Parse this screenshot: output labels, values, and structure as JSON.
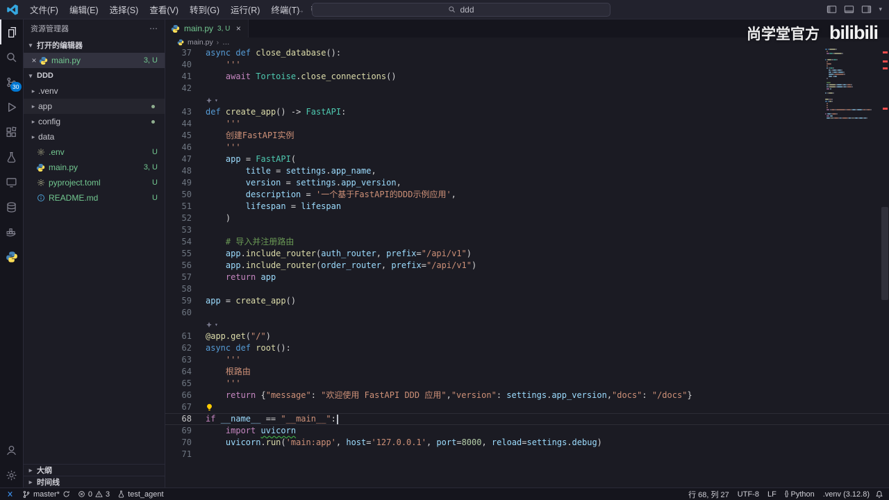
{
  "titlebar": {
    "menus": [
      "文件(F)",
      "编辑(E)",
      "选择(S)",
      "查看(V)",
      "转到(G)",
      "运行(R)",
      "终端(T)",
      "帮助(H)"
    ],
    "search_text": "ddd"
  },
  "activity": {
    "scm_badge": "30"
  },
  "sidebar": {
    "title": "资源管理器",
    "open_editors_label": "打开的编辑器",
    "open_editors": [
      {
        "name": "main.py",
        "badge": "3, U",
        "icon": "python",
        "selected": true
      }
    ],
    "project_label": "DDD",
    "tree": [
      {
        "kind": "folder",
        "name": ".venv"
      },
      {
        "kind": "folder",
        "name": "app",
        "dot": true,
        "focused": true
      },
      {
        "kind": "folder",
        "name": "config",
        "dot": true
      },
      {
        "kind": "folder",
        "name": "data"
      },
      {
        "kind": "file",
        "icon": "gear",
        "name": ".env",
        "badge": "U"
      },
      {
        "kind": "file",
        "icon": "python",
        "name": "main.py",
        "badge": "3, U"
      },
      {
        "kind": "file",
        "icon": "gear",
        "name": "pyproject.toml",
        "badge": "U"
      },
      {
        "kind": "file",
        "icon": "info",
        "name": "README.md",
        "badge": "U"
      }
    ],
    "outline_label": "大纲",
    "timeline_label": "时间线"
  },
  "editor": {
    "tab_name": "main.py",
    "tab_badge": "3, U",
    "breadcrumb_file": "main.py",
    "breadcrumb_more": "…",
    "lines": [
      {
        "n": 37,
        "t": [
          [
            "async",
            "k"
          ],
          [
            " ",
            "p"
          ],
          [
            "def",
            "k"
          ],
          [
            " ",
            "p"
          ],
          [
            "close_database",
            "f"
          ],
          [
            "():",
            "p"
          ]
        ]
      },
      {
        "n": 40,
        "t": [
          [
            "    '''",
            "s"
          ]
        ]
      },
      {
        "n": 41,
        "t": [
          [
            "    ",
            "p"
          ],
          [
            "await",
            "c"
          ],
          [
            " ",
            "p"
          ],
          [
            "Tortoise",
            "t"
          ],
          [
            ".",
            "p"
          ],
          [
            "close_connections",
            "f"
          ],
          [
            "()",
            "p"
          ]
        ]
      },
      {
        "n": 42,
        "t": []
      },
      {
        "decor": true
      },
      {
        "n": 43,
        "t": [
          [
            "def",
            "k"
          ],
          [
            " ",
            "p"
          ],
          [
            "create_app",
            "f"
          ],
          [
            "() -> ",
            "p"
          ],
          [
            "FastAPI",
            "t"
          ],
          [
            ":",
            "p"
          ]
        ]
      },
      {
        "n": 44,
        "t": [
          [
            "    '''",
            "s"
          ]
        ]
      },
      {
        "n": 45,
        "t": [
          [
            "    创建FastAPI实例",
            "s"
          ]
        ]
      },
      {
        "n": 46,
        "t": [
          [
            "    '''",
            "s"
          ]
        ]
      },
      {
        "n": 47,
        "t": [
          [
            "    ",
            "p"
          ],
          [
            "app",
            "v"
          ],
          [
            " = ",
            "p"
          ],
          [
            "FastAPI",
            "t"
          ],
          [
            "(",
            "p"
          ]
        ]
      },
      {
        "n": 48,
        "t": [
          [
            "        ",
            "p"
          ],
          [
            "title",
            "v"
          ],
          [
            " = ",
            "p"
          ],
          [
            "settings",
            "v"
          ],
          [
            ".",
            "p"
          ],
          [
            "app_name",
            "v"
          ],
          [
            ",",
            "p"
          ]
        ]
      },
      {
        "n": 49,
        "t": [
          [
            "        ",
            "p"
          ],
          [
            "version",
            "v"
          ],
          [
            " = ",
            "p"
          ],
          [
            "settings",
            "v"
          ],
          [
            ".",
            "p"
          ],
          [
            "app_version",
            "v"
          ],
          [
            ",",
            "p"
          ]
        ]
      },
      {
        "n": 50,
        "t": [
          [
            "        ",
            "p"
          ],
          [
            "description",
            "v"
          ],
          [
            " = ",
            "p"
          ],
          [
            "'一个基于FastAPI的DDD示例应用'",
            "s"
          ],
          [
            ",",
            "p"
          ]
        ]
      },
      {
        "n": 51,
        "t": [
          [
            "        ",
            "p"
          ],
          [
            "lifespan",
            "v"
          ],
          [
            " = ",
            "p"
          ],
          [
            "lifespan",
            "v"
          ]
        ]
      },
      {
        "n": 52,
        "t": [
          [
            "    )",
            "p"
          ]
        ]
      },
      {
        "n": 53,
        "t": []
      },
      {
        "n": 54,
        "t": [
          [
            "    ",
            "p"
          ],
          [
            "# 导入并注册路由",
            "m"
          ]
        ]
      },
      {
        "n": 55,
        "t": [
          [
            "    ",
            "p"
          ],
          [
            "app",
            "v"
          ],
          [
            ".",
            "p"
          ],
          [
            "include_router",
            "f"
          ],
          [
            "(",
            "p"
          ],
          [
            "auth_router",
            "v"
          ],
          [
            ", ",
            "p"
          ],
          [
            "prefix",
            "v"
          ],
          [
            "=",
            "p"
          ],
          [
            "\"/api/v1\"",
            "s"
          ],
          [
            ")",
            "p"
          ]
        ]
      },
      {
        "n": 56,
        "t": [
          [
            "    ",
            "p"
          ],
          [
            "app",
            "v"
          ],
          [
            ".",
            "p"
          ],
          [
            "include_router",
            "f"
          ],
          [
            "(",
            "p"
          ],
          [
            "order_router",
            "v"
          ],
          [
            ", ",
            "p"
          ],
          [
            "prefix",
            "v"
          ],
          [
            "=",
            "p"
          ],
          [
            "\"/api/v1\"",
            "s"
          ],
          [
            ")",
            "p"
          ]
        ]
      },
      {
        "n": 57,
        "t": [
          [
            "    ",
            "p"
          ],
          [
            "return",
            "c"
          ],
          [
            " ",
            "p"
          ],
          [
            "app",
            "v"
          ]
        ]
      },
      {
        "n": 58,
        "t": []
      },
      {
        "n": 59,
        "t": [
          [
            "app",
            "v"
          ],
          [
            " = ",
            "p"
          ],
          [
            "create_app",
            "f"
          ],
          [
            "()",
            "p"
          ]
        ]
      },
      {
        "n": 60,
        "t": []
      },
      {
        "decor": true
      },
      {
        "n": 61,
        "t": [
          [
            "@app.get",
            "d"
          ],
          [
            "(",
            "p"
          ],
          [
            "\"/\"",
            "s"
          ],
          [
            ")",
            "p"
          ]
        ]
      },
      {
        "n": 62,
        "t": [
          [
            "async",
            "k"
          ],
          [
            " ",
            "p"
          ],
          [
            "def",
            "k"
          ],
          [
            " ",
            "p"
          ],
          [
            "root",
            "f"
          ],
          [
            "():",
            "p"
          ]
        ]
      },
      {
        "n": 63,
        "t": [
          [
            "    '''",
            "s"
          ]
        ]
      },
      {
        "n": 64,
        "t": [
          [
            "    根路由",
            "s"
          ]
        ]
      },
      {
        "n": 65,
        "t": [
          [
            "    '''",
            "s"
          ]
        ]
      },
      {
        "n": 66,
        "t": [
          [
            "    ",
            "p"
          ],
          [
            "return",
            "c"
          ],
          [
            " {",
            "p"
          ],
          [
            "\"message\"",
            "s"
          ],
          [
            ": ",
            "p"
          ],
          [
            "\"欢迎使用 FastAPI DDD 应用\"",
            "s"
          ],
          [
            ",",
            "p"
          ],
          [
            "\"version\"",
            "s"
          ],
          [
            ": ",
            "p"
          ],
          [
            "settings",
            "v"
          ],
          [
            ".",
            "p"
          ],
          [
            "app_version",
            "v"
          ],
          [
            ",",
            "p"
          ],
          [
            "\"docs\"",
            "s"
          ],
          [
            ": ",
            "p"
          ],
          [
            "\"/docs\"",
            "s"
          ],
          [
            "}",
            "p"
          ]
        ]
      },
      {
        "n": 67,
        "bulb": true,
        "t": []
      },
      {
        "n": 68,
        "cur": true,
        "cursor": true,
        "t": [
          [
            "if",
            "c"
          ],
          [
            " ",
            "p"
          ],
          [
            "__name__",
            "v"
          ],
          [
            " == ",
            "p"
          ],
          [
            "\"__main__\"",
            "s"
          ],
          [
            ":",
            "p"
          ]
        ]
      },
      {
        "n": 69,
        "t": [
          [
            "    ",
            "p"
          ],
          [
            "import",
            "c"
          ],
          [
            " ",
            "p"
          ],
          [
            "uvicorn",
            "v",
            "sq"
          ]
        ]
      },
      {
        "n": 70,
        "t": [
          [
            "    ",
            "p"
          ],
          [
            "uvicorn",
            "v"
          ],
          [
            ".",
            "p"
          ],
          [
            "run",
            "f"
          ],
          [
            "(",
            "p"
          ],
          [
            "'main:app'",
            "s"
          ],
          [
            ", ",
            "p"
          ],
          [
            "host",
            "v"
          ],
          [
            "=",
            "p"
          ],
          [
            "'127.0.0.1'",
            "s"
          ],
          [
            ", ",
            "p"
          ],
          [
            "port",
            "v"
          ],
          [
            "=",
            "p"
          ],
          [
            "8000",
            "n"
          ],
          [
            ", ",
            "p"
          ],
          [
            "reload",
            "v"
          ],
          [
            "=",
            "p"
          ],
          [
            "settings",
            "v"
          ],
          [
            ".",
            "p"
          ],
          [
            "debug",
            "v"
          ],
          [
            ")",
            "p"
          ]
        ]
      },
      {
        "n": 71,
        "t": []
      }
    ]
  },
  "overlay": {
    "watermark_text": "尚学堂官方",
    "watermark_logo": "bilibili"
  },
  "statusbar": {
    "branch": "master*",
    "errors": "0",
    "warnings": "3",
    "test_label": "test_agent",
    "position": "行 68, 列 27",
    "encoding": "UTF-8",
    "eol": "LF",
    "lang_icon": "{}",
    "language": "Python",
    "interpreter": ".venv (3.12.8)"
  }
}
